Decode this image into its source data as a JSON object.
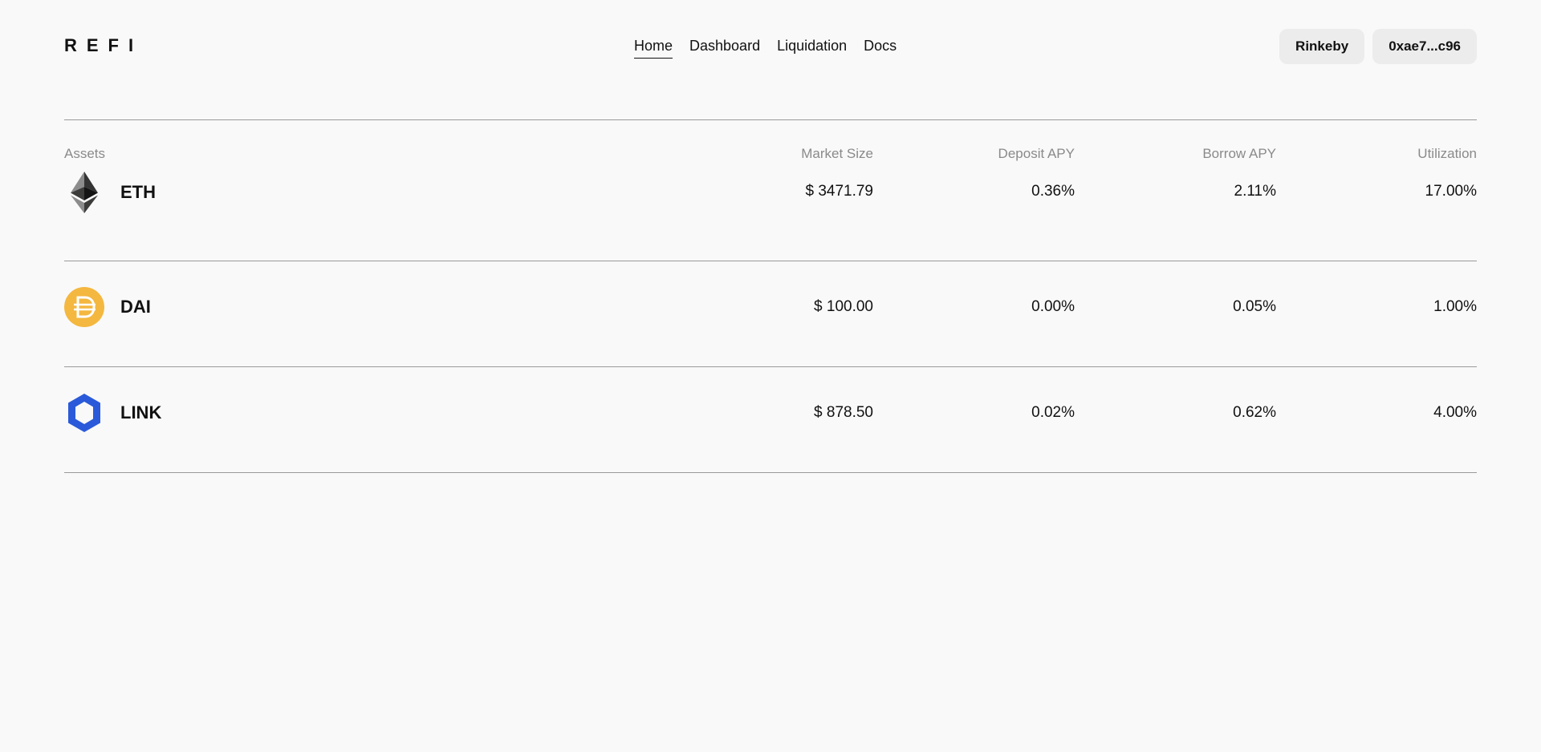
{
  "header": {
    "logo": "REFI",
    "nav": [
      {
        "label": "Home",
        "active": true
      },
      {
        "label": "Dashboard",
        "active": false
      },
      {
        "label": "Liquidation",
        "active": false
      },
      {
        "label": "Docs",
        "active": false
      }
    ],
    "network_button": "Rinkeby",
    "account_button": "0xae7...c96"
  },
  "table": {
    "columns": [
      "Assets",
      "Market Size",
      "Deposit APY",
      "Borrow APY",
      "Utilization"
    ],
    "rows": [
      {
        "asset": "ETH",
        "icon": "eth-icon",
        "market_size": "$ 3471.79",
        "deposit_apy": "0.36%",
        "borrow_apy": "2.11%",
        "utilization": "17.00%"
      },
      {
        "asset": "DAI",
        "icon": "dai-icon",
        "market_size": "$ 100.00",
        "deposit_apy": "0.00%",
        "borrow_apy": "0.05%",
        "utilization": "1.00%"
      },
      {
        "asset": "LINK",
        "icon": "link-icon",
        "market_size": "$ 878.50",
        "deposit_apy": "0.02%",
        "borrow_apy": "0.62%",
        "utilization": "4.00%"
      }
    ]
  },
  "colors": {
    "background": "#f9f9f9",
    "dai": "#f4b73f",
    "link": "#2a5ada",
    "button_bg": "#ececec"
  }
}
